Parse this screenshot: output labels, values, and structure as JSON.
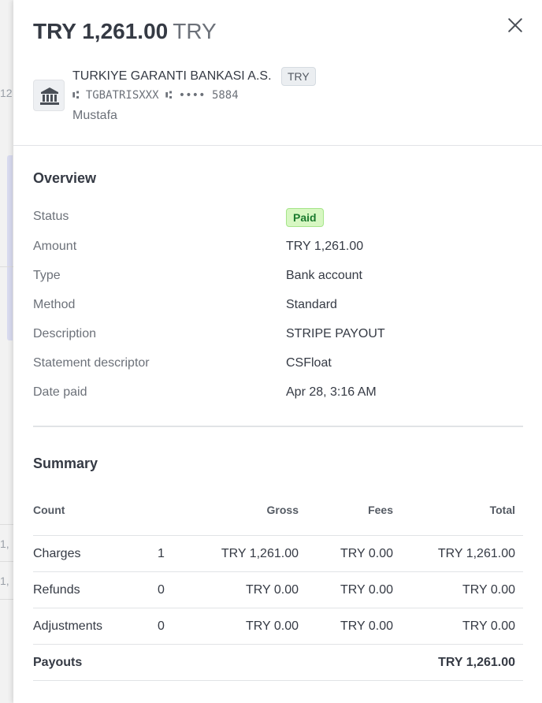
{
  "background": {
    "numbers": [
      "12",
      "1,",
      "1,"
    ]
  },
  "header": {
    "amount": "TRY 1,261.00",
    "currency": "TRY",
    "bank": {
      "icon": "bank-icon",
      "name": "TURKIYE GARANTI BANKASI A.S.",
      "currency_badge": "TRY",
      "account_line": "⑆ TGBATRISXXX ⑆ •••• 5884",
      "holder": "Mustafa"
    }
  },
  "overview": {
    "title": "Overview",
    "rows": [
      {
        "label": "Status",
        "value": "Paid"
      },
      {
        "label": "Amount",
        "value": "TRY 1,261.00"
      },
      {
        "label": "Type",
        "value": "Bank account"
      },
      {
        "label": "Method",
        "value": "Standard"
      },
      {
        "label": "Description",
        "value": "STRIPE PAYOUT"
      },
      {
        "label": "Statement descriptor",
        "value": "CSFloat"
      },
      {
        "label": "Date paid",
        "value": "Apr 28, 3:16 AM"
      }
    ]
  },
  "summary": {
    "title": "Summary",
    "columns": [
      "Count",
      "Gross",
      "Fees",
      "Total"
    ],
    "rows": [
      {
        "label": "Charges",
        "count": "1",
        "gross": "TRY 1,261.00",
        "fees": "TRY 0.00",
        "total": "TRY 1,261.00"
      },
      {
        "label": "Refunds",
        "count": "0",
        "gross": "TRY 0.00",
        "fees": "TRY 0.00",
        "total": "TRY 0.00"
      },
      {
        "label": "Adjustments",
        "count": "0",
        "gross": "TRY 0.00",
        "fees": "TRY 0.00",
        "total": "TRY 0.00"
      }
    ],
    "payouts": {
      "label": "Payouts",
      "total": "TRY 1,261.00"
    }
  },
  "colors": {
    "paid_badge_bg": "#d7f7c2",
    "paid_badge_text": "#1b7a2e"
  }
}
